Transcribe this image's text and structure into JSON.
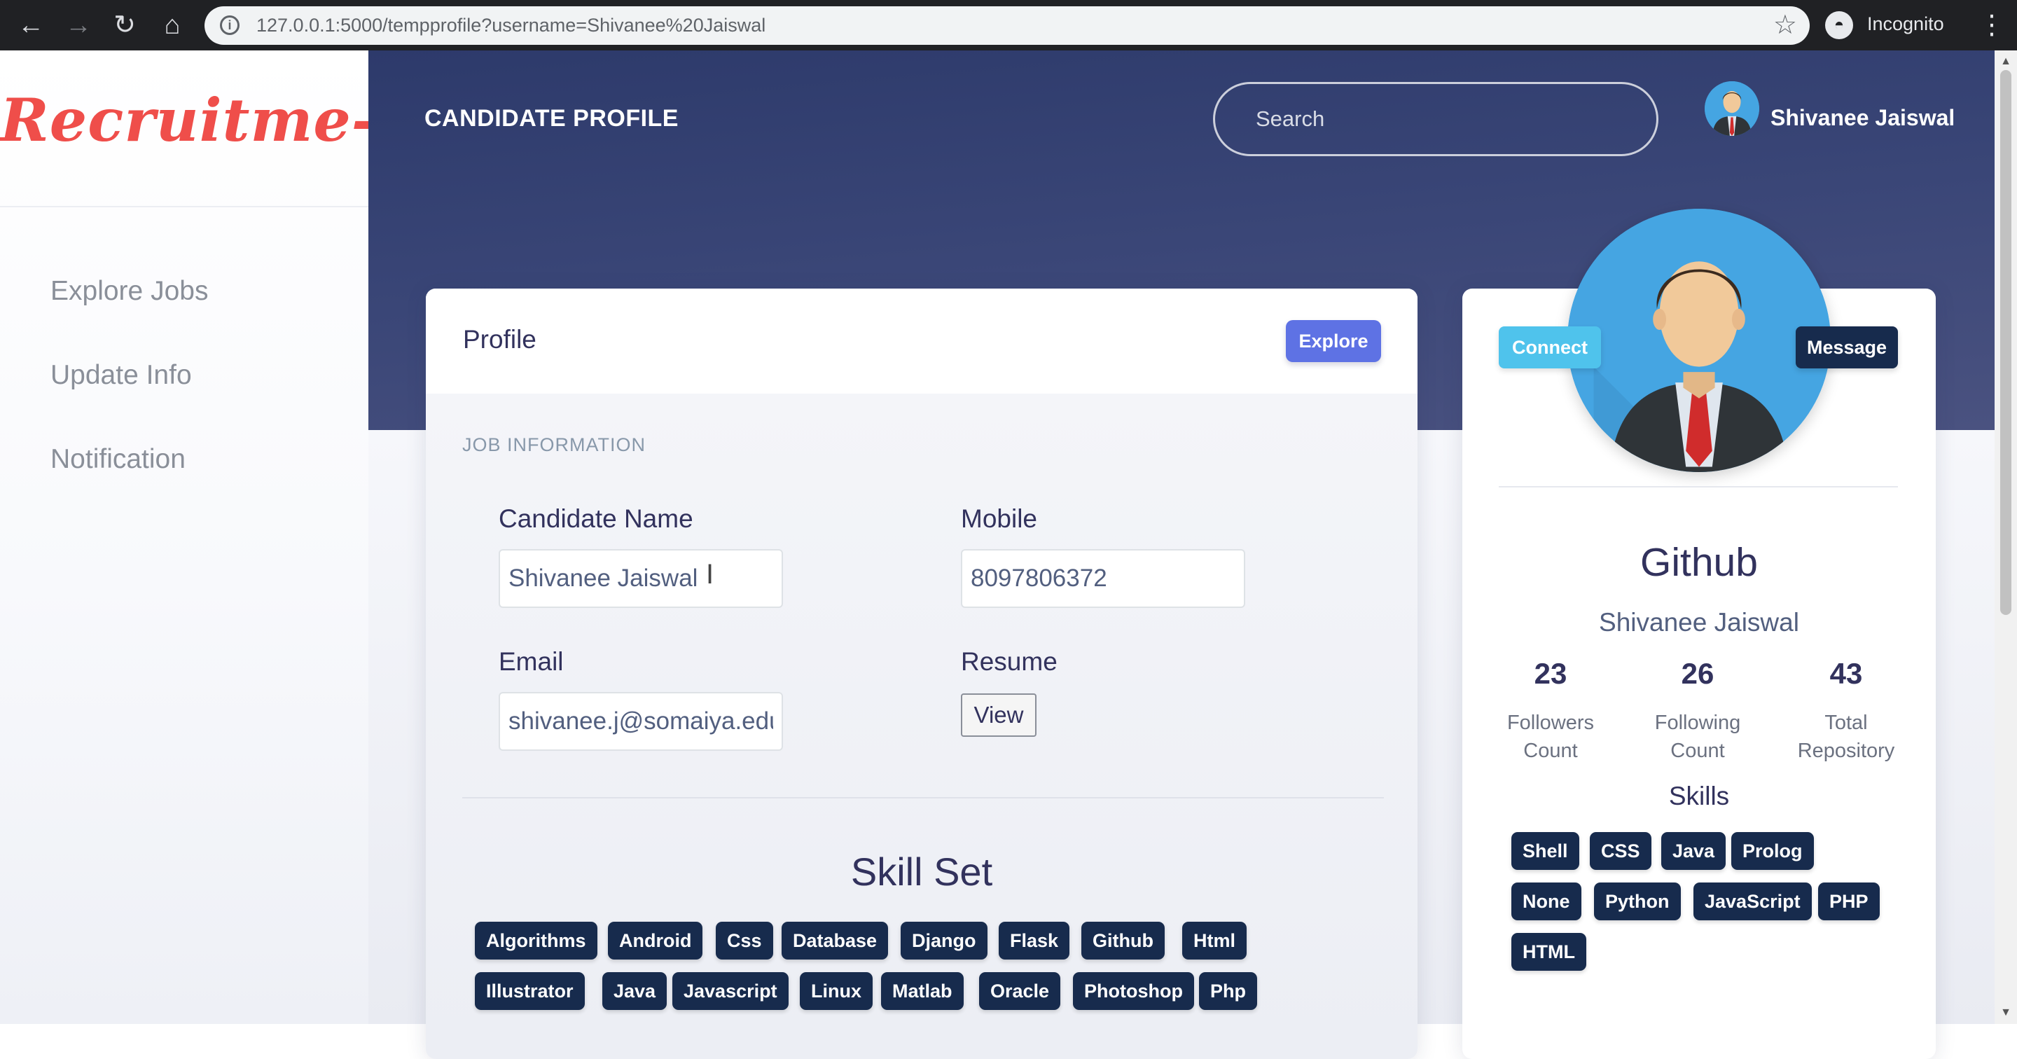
{
  "browser": {
    "url": "127.0.0.1:5000/tempprofile?username=Shivanee%20Jaiswal",
    "mode_label": "Incognito"
  },
  "sidebar": {
    "logo": "Recruitme-",
    "items": [
      {
        "label": "Explore Jobs"
      },
      {
        "label": "Update Info"
      },
      {
        "label": "Notification"
      }
    ]
  },
  "header": {
    "title": "CANDIDATE PROFILE",
    "search_placeholder": "Search",
    "user_name": "Shivanee Jaiswal"
  },
  "profile": {
    "heading": "Profile",
    "explore_label": "Explore",
    "section_label": "JOB INFORMATION",
    "fields": {
      "name_label": "Candidate Name",
      "name_value": "Shivanee Jaiswal",
      "mobile_label": "Mobile",
      "mobile_value": "8097806372",
      "email_label": "Email",
      "email_value": "shivanee.j@somaiya.edu",
      "resume_label": "Resume",
      "resume_button": "View"
    },
    "skill_set_title": "Skill Set",
    "skills": [
      "Algorithms",
      "Android",
      "Css",
      "Database",
      "Django",
      "Flask",
      "Github",
      "Html",
      "Illustrator",
      "Java",
      "Javascript",
      "Linux",
      "Matlab",
      "Oracle",
      "Photoshop",
      "Php"
    ]
  },
  "github": {
    "connect_label": "Connect",
    "message_label": "Message",
    "title": "Github",
    "user_name": "Shivanee Jaiswal",
    "stats": [
      {
        "value": "23",
        "label_line1": "Followers",
        "label_line2": "Count"
      },
      {
        "value": "26",
        "label_line1": "Following",
        "label_line2": "Count"
      },
      {
        "value": "43",
        "label_line1": "Total",
        "label_line2": "Repository"
      }
    ],
    "skills_label": "Skills",
    "skills": [
      "Shell",
      "CSS",
      "Java",
      "Prolog",
      "None",
      "Python",
      "JavaScript",
      "PHP",
      "HTML"
    ]
  },
  "colors": {
    "logo": "#ef4e4a",
    "header_bg": "#2d3a6b",
    "chip_bg": "#172b4d",
    "explore_btn": "#5e72e4",
    "connect_btn": "#4fc3ec"
  }
}
